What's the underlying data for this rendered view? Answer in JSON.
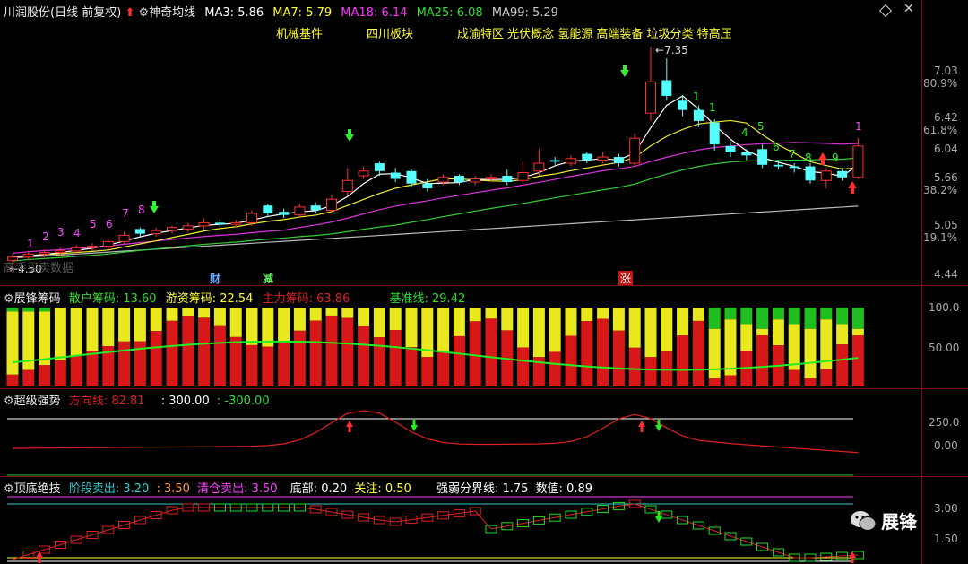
{
  "main": {
    "stock": "川润股份",
    "mode": "(日线 前复权)",
    "indicator": "神奇均线",
    "ma": [
      {
        "label": "MA3:",
        "value": "5.86",
        "color": "#ffffff"
      },
      {
        "label": "MA7:",
        "value": "5.79",
        "color": "#ffff33"
      },
      {
        "label": "MA18:",
        "value": "6.14",
        "color": "#ff33ff"
      },
      {
        "label": "MA25:",
        "value": "6.08",
        "color": "#33dd33"
      },
      {
        "label": "MA99:",
        "value": "5.29",
        "color": "#cccccc"
      }
    ],
    "concepts": [
      "机械基件",
      "四川板块",
      "成渝特区 光伏概念 氢能源 高端装备 垃圾分类 特高压"
    ],
    "price_labels": [
      "7.03",
      "80.9%",
      "6.42",
      "61.8%",
      "6.04",
      "5.66",
      "38.2%",
      "5.05",
      "19.1%",
      "4.44"
    ],
    "high_label": "7.35",
    "low_label": "4.50",
    "badges": [
      "财",
      "减",
      "涨"
    ],
    "watermark": "高手买卖数据",
    "counts_purple": [
      "1",
      "2",
      "3",
      "4",
      "5",
      "6",
      "7",
      "8"
    ],
    "counts_green": [
      "1",
      "1",
      "4",
      "5",
      "6",
      "7",
      "8",
      "9"
    ],
    "count_top": "1",
    "diamond_icon": "diamond-outline-icon",
    "close_icon": "x-icon"
  },
  "panel1": {
    "title": "展锋筹码",
    "items": [
      {
        "label": "散户筹码:",
        "value": "13.60",
        "color": "#33dd33"
      },
      {
        "label": "游资筹码:",
        "value": "22.54",
        "color": "#ffff33"
      },
      {
        "label": "主力筹码:",
        "value": "63.86",
        "color": "#dd2222"
      },
      {
        "label": "基准线:",
        "value": "29.42",
        "color": "#33dd33"
      }
    ],
    "axis": [
      "100.0",
      "50.00"
    ]
  },
  "panel2": {
    "title": "超级强势",
    "items": [
      {
        "label": "方向线:",
        "value": "82.81",
        "color": "#dd2222"
      },
      {
        "label": ":",
        "value": "300.00",
        "color": "#ffffff"
      },
      {
        "label": ":",
        "value": "-300.00",
        "color": "#33dd33"
      }
    ],
    "axis": [
      "250.0",
      "0.00"
    ]
  },
  "panel3": {
    "title": "顶底绝技",
    "items": [
      {
        "label": "阶段卖出:",
        "value": "3.20",
        "color": "#33cccc"
      },
      {
        "label": ":",
        "value": "3.50",
        "color": "#ff9933"
      },
      {
        "label": "清仓卖出:",
        "value": "3.50",
        "color": "#ff44ff"
      },
      {
        "label": "底部:",
        "value": "0.20",
        "color": "#ffffff"
      },
      {
        "label": "关注:",
        "value": "0.50",
        "color": "#ffff33"
      },
      {
        "label": "强弱分界线:",
        "value": "1.75",
        "color": "#ffffff"
      },
      {
        "label": "数值:",
        "value": "0.89",
        "color": "#ffffff"
      }
    ],
    "axis": [
      "3.00",
      "1.50"
    ]
  },
  "brand": {
    "name": "展锋",
    "icon": "wechat-icon"
  },
  "chart_data": {
    "type": "candlestick",
    "price_range": [
      4.44,
      7.35
    ],
    "candles": [
      {
        "o": 4.62,
        "c": 4.66,
        "h": 4.7,
        "l": 4.5
      },
      {
        "o": 4.66,
        "c": 4.7,
        "h": 4.74,
        "l": 4.62
      },
      {
        "o": 4.7,
        "c": 4.72,
        "h": 4.76,
        "l": 4.66
      },
      {
        "o": 4.72,
        "c": 4.74,
        "h": 4.78,
        "l": 4.68
      },
      {
        "o": 4.74,
        "c": 4.78,
        "h": 4.82,
        "l": 4.7
      },
      {
        "o": 4.78,
        "c": 4.8,
        "h": 4.84,
        "l": 4.74
      },
      {
        "o": 4.8,
        "c": 4.86,
        "h": 4.9,
        "l": 4.76
      },
      {
        "o": 4.86,
        "c": 4.94,
        "h": 4.98,
        "l": 4.82
      },
      {
        "o": 5.02,
        "c": 4.96,
        "h": 5.04,
        "l": 4.92
      },
      {
        "o": 4.96,
        "c": 5.0,
        "h": 5.04,
        "l": 4.92
      },
      {
        "o": 5.0,
        "c": 5.04,
        "h": 5.06,
        "l": 4.96
      },
      {
        "o": 5.02,
        "c": 5.06,
        "h": 5.1,
        "l": 4.98
      },
      {
        "o": 5.06,
        "c": 5.1,
        "h": 5.16,
        "l": 5.02
      },
      {
        "o": 5.1,
        "c": 5.08,
        "h": 5.14,
        "l": 5.04
      },
      {
        "o": 5.08,
        "c": 5.1,
        "h": 5.14,
        "l": 5.04
      },
      {
        "o": 5.1,
        "c": 5.22,
        "h": 5.26,
        "l": 5.06
      },
      {
        "o": 5.32,
        "c": 5.22,
        "h": 5.34,
        "l": 5.18
      },
      {
        "o": 5.24,
        "c": 5.2,
        "h": 5.28,
        "l": 5.16
      },
      {
        "o": 5.2,
        "c": 5.3,
        "h": 5.34,
        "l": 5.16
      },
      {
        "o": 5.32,
        "c": 5.26,
        "h": 5.36,
        "l": 5.22
      },
      {
        "o": 5.26,
        "c": 5.4,
        "h": 5.46,
        "l": 5.22
      },
      {
        "o": 5.5,
        "c": 5.64,
        "h": 5.8,
        "l": 5.44
      },
      {
        "o": 5.7,
        "c": 5.76,
        "h": 5.82,
        "l": 5.66
      },
      {
        "o": 5.86,
        "c": 5.76,
        "h": 5.88,
        "l": 5.7
      },
      {
        "o": 5.74,
        "c": 5.66,
        "h": 5.8,
        "l": 5.62
      },
      {
        "o": 5.76,
        "c": 5.6,
        "h": 5.78,
        "l": 5.56
      },
      {
        "o": 5.6,
        "c": 5.54,
        "h": 5.66,
        "l": 5.5
      },
      {
        "o": 5.62,
        "c": 5.68,
        "h": 5.72,
        "l": 5.58
      },
      {
        "o": 5.7,
        "c": 5.62,
        "h": 5.72,
        "l": 5.58
      },
      {
        "o": 5.62,
        "c": 5.66,
        "h": 5.7,
        "l": 5.58
      },
      {
        "o": 5.66,
        "c": 5.68,
        "h": 5.72,
        "l": 5.62
      },
      {
        "o": 5.7,
        "c": 5.62,
        "h": 5.78,
        "l": 5.58
      },
      {
        "o": 5.64,
        "c": 5.74,
        "h": 5.88,
        "l": 5.6
      },
      {
        "o": 5.76,
        "c": 5.86,
        "h": 6.04,
        "l": 5.7
      },
      {
        "o": 5.9,
        "c": 5.88,
        "h": 5.94,
        "l": 5.84
      },
      {
        "o": 5.86,
        "c": 5.92,
        "h": 5.96,
        "l": 5.82
      },
      {
        "o": 5.98,
        "c": 5.9,
        "h": 6.0,
        "l": 5.86
      },
      {
        "o": 5.9,
        "c": 5.94,
        "h": 6.0,
        "l": 5.86
      },
      {
        "o": 5.94,
        "c": 5.86,
        "h": 5.98,
        "l": 5.82
      },
      {
        "o": 5.86,
        "c": 6.18,
        "h": 6.24,
        "l": 5.82
      },
      {
        "o": 6.5,
        "c": 6.9,
        "h": 7.35,
        "l": 6.4
      },
      {
        "o": 6.92,
        "c": 6.72,
        "h": 7.2,
        "l": 6.66
      },
      {
        "o": 6.66,
        "c": 6.54,
        "h": 6.72,
        "l": 6.46
      },
      {
        "o": 6.54,
        "c": 6.4,
        "h": 6.6,
        "l": 6.32
      },
      {
        "o": 6.38,
        "c": 6.1,
        "h": 6.42,
        "l": 6.02
      },
      {
        "o": 6.08,
        "c": 6.0,
        "h": 6.14,
        "l": 5.94
      },
      {
        "o": 6.0,
        "c": 5.96,
        "h": 6.04,
        "l": 5.9
      },
      {
        "o": 6.04,
        "c": 5.84,
        "h": 6.1,
        "l": 5.8
      },
      {
        "o": 5.84,
        "c": 5.82,
        "h": 5.9,
        "l": 5.78
      },
      {
        "o": 5.82,
        "c": 5.8,
        "h": 5.86,
        "l": 5.74
      },
      {
        "o": 5.82,
        "c": 5.64,
        "h": 5.86,
        "l": 5.6
      },
      {
        "o": 5.64,
        "c": 5.76,
        "h": 5.8,
        "l": 5.54
      },
      {
        "o": 5.76,
        "c": 5.68,
        "h": 5.8,
        "l": 5.64
      },
      {
        "o": 5.68,
        "c": 6.08,
        "h": 6.18,
        "l": 5.66
      }
    ]
  }
}
